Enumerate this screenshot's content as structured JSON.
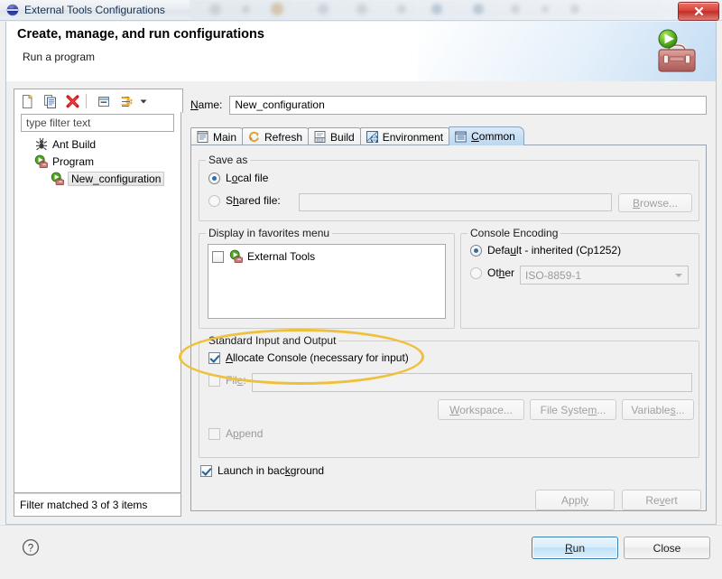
{
  "window": {
    "title": "External Tools Configurations",
    "title_icon": "eclipse-sphere-icon",
    "close_label": "x"
  },
  "header": {
    "title": "Create, manage, and run configurations",
    "subtitle": "Run a program",
    "icon": "toolbox-run-icon"
  },
  "left_panel": {
    "toolbar": [
      {
        "name": "new-launch-configuration",
        "icon": "new-document-icon"
      },
      {
        "name": "duplicate-launch-configuration",
        "icon": "copy-document-icon"
      },
      {
        "name": "delete-launch-configuration",
        "icon": "red-x-delete-icon"
      },
      {
        "name": "collapse-all",
        "icon": "collapse-all-icon"
      },
      {
        "name": "filter-launch-configurations",
        "icon": "filter-arrows-icon"
      },
      {
        "name": "view-menu",
        "icon": "chevron-down-icon"
      }
    ],
    "filter": {
      "value": "",
      "placeholder": "type filter text"
    },
    "tree": [
      {
        "label": "Ant Build",
        "icon": "ant-build-icon",
        "level": 1,
        "selected": false
      },
      {
        "label": "Program",
        "icon": "program-toolbox-icon",
        "level": 1,
        "selected": false
      },
      {
        "label": "New_configuration",
        "icon": "program-toolbox-icon",
        "level": 2,
        "selected": true
      }
    ],
    "status": "Filter matched 3 of 3 items"
  },
  "right_panel": {
    "name_label": "Name:",
    "name_label_mnemonic": "N",
    "name_value": "New_configuration",
    "tabs": [
      {
        "label": "Main",
        "icon": "main-tab-icon",
        "active": false
      },
      {
        "label": "Refresh",
        "icon": "refresh-tab-icon",
        "active": false
      },
      {
        "label": "Build",
        "icon": "build-tab-icon",
        "active": false
      },
      {
        "label": "Environment",
        "icon": "environment-tab-icon",
        "active": false
      },
      {
        "label": "Common",
        "icon": "common-tab-icon",
        "active": true,
        "mnemonic": "C"
      }
    ],
    "common_tab": {
      "save_as": {
        "title": "Save as",
        "local_file": {
          "label": "Local file",
          "checked": true
        },
        "shared_file": {
          "label": "Shared file:",
          "checked": false,
          "value": "",
          "enabled": false
        },
        "browse_button": {
          "label": "Browse...",
          "enabled": false
        }
      },
      "favorites": {
        "title": "Display in favorites menu",
        "items": [
          {
            "label": "External Tools",
            "checked": false,
            "icon": "program-toolbox-icon"
          }
        ]
      },
      "console_encoding": {
        "title": "Console Encoding",
        "default_option": {
          "label": "Default - inherited (Cp1252)",
          "checked": true
        },
        "other_option": {
          "label": "Other",
          "checked": false
        },
        "other_value": "ISO-8859-1",
        "other_enabled": false
      },
      "stdio": {
        "title": "Standard Input and Output",
        "allocate_console": {
          "label": "Allocate Console (necessary for input)",
          "checked": true
        },
        "file": {
          "label": "File:",
          "checked": false,
          "value": "",
          "enabled": false
        },
        "workspace_button": {
          "label": "Workspace...",
          "enabled": false
        },
        "file_system_button": {
          "label": "File System...",
          "enabled": false
        },
        "variables_button": {
          "label": "Variables...",
          "enabled": false
        },
        "append": {
          "label": "Append",
          "checked": false,
          "enabled": false
        }
      },
      "launch_in_background": {
        "label": "Launch in background",
        "checked": true
      }
    },
    "apply_button": {
      "label": "Apply",
      "enabled": false
    },
    "revert_button": {
      "label": "Revert",
      "enabled": false
    }
  },
  "footer": {
    "help_icon": "question-mark-help-icon",
    "run_button": {
      "label": "Run",
      "default": true
    },
    "close_button": {
      "label": "Close",
      "default": false
    }
  },
  "annotation": {
    "type": "ellipse-highlight",
    "color": "#edc13c",
    "targets": "Allocate Console (necessary for input)"
  }
}
